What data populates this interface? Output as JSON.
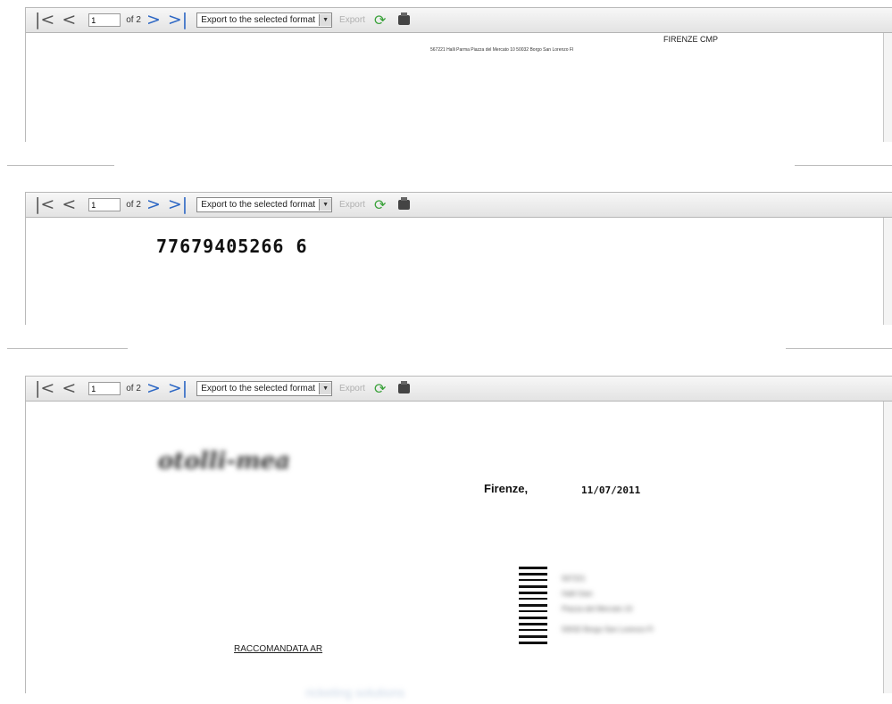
{
  "toolbar": {
    "page_value": "1",
    "of_text": "of 2",
    "export_select": "Export to the selected format",
    "export_label": "Export"
  },
  "panel1": {
    "title": "FIRENZE CMP",
    "address": "567221 Halli Parma Piazza del Mercato 10 50032 Borgo San Lorenzo FI"
  },
  "panel2": {
    "number": "77679405266 6"
  },
  "panel3": {
    "logo_text": "otolli-mea",
    "city": "Firenze,",
    "date": "11/07/2011",
    "recipient": [
      "567221",
      "Halli Gian",
      "Piazza del Mercato 10",
      "50032 Borgo San Lorenzo FI"
    ],
    "raccomandata": "RACCOMANDATA AR"
  },
  "footer": {
    "text": "ricketing solutions"
  },
  "icons": {
    "first": "first-page-icon",
    "prev": "prev-page-icon",
    "next": "next-page-icon",
    "last": "last-page-icon",
    "refresh": "refresh-icon",
    "print": "print-icon"
  }
}
